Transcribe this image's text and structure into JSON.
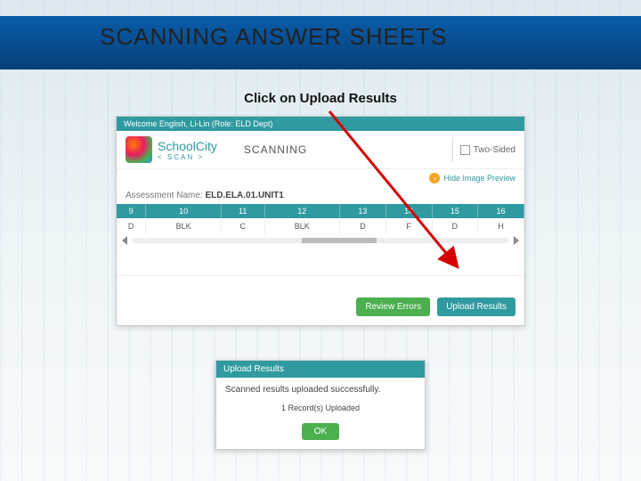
{
  "title": "SCANNING ANSWER SHEETS",
  "instruction": "Click on Upload Results",
  "app": {
    "welcome": "Welcome English, Li-Lin (Role: ELD Dept)",
    "brand": "SchoolCity",
    "brand_sub": "< SCAN >",
    "mode": "SCANNING",
    "two_sided": "Two-Sided",
    "hide_preview": "Hide Image Preview",
    "assessment_label": "Assessment Name:",
    "assessment_value": "ELD.ELA.01.UNIT1",
    "headers": [
      "9",
      "10",
      "11",
      "12",
      "13",
      "14",
      "15",
      "16"
    ],
    "row": [
      "D",
      "BLK",
      "C",
      "BLK",
      "D",
      "F",
      "D",
      "H"
    ],
    "btn_review": "Review Errors",
    "btn_upload": "Upload Results"
  },
  "dialog": {
    "title": "Upload Results",
    "message": "Scanned results uploaded successfully.",
    "count": "1 Record(s) Uploaded",
    "ok": "OK"
  }
}
